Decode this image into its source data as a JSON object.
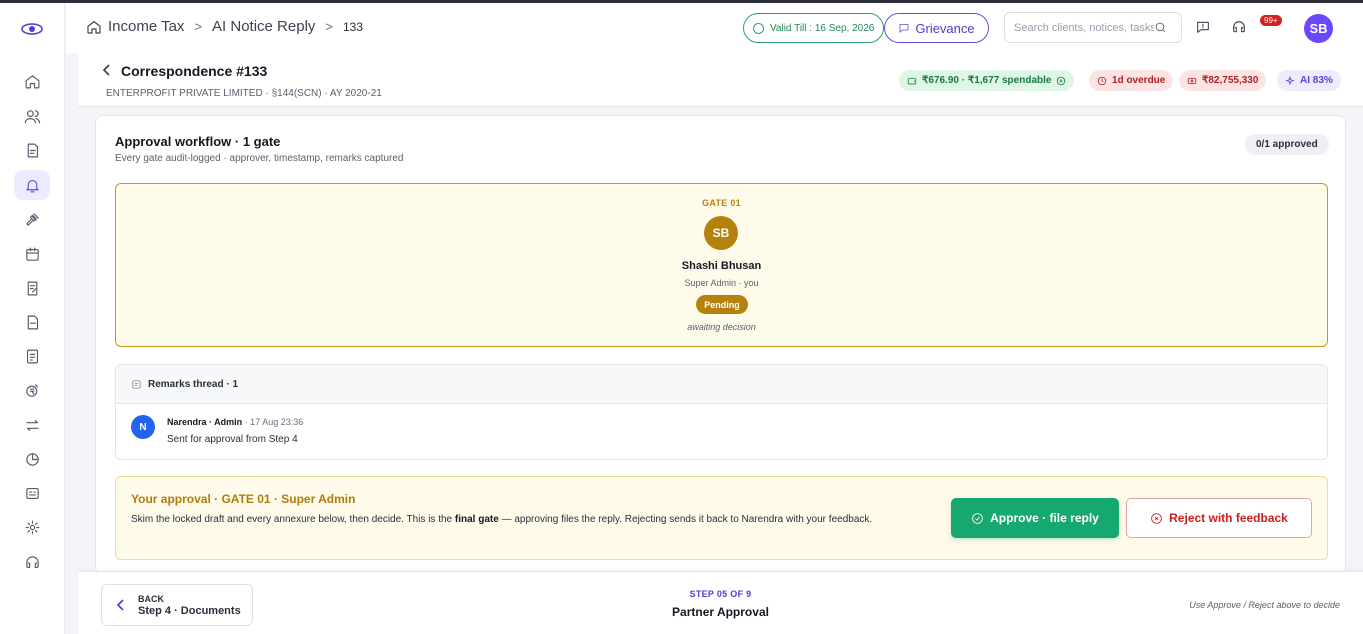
{
  "header": {
    "breadcrumbs": [
      "Income Tax",
      "AI Notice Reply",
      "133"
    ],
    "valid_till": "Valid Till : 16 Sep, 2026",
    "grievance_label": "Grievance",
    "search_placeholder": "Search clients, notices, tasks…",
    "notification_count": "99+",
    "user_initials": "SB"
  },
  "sidebar": {
    "items": [
      {
        "icon": "home-icon"
      },
      {
        "icon": "users-icon"
      },
      {
        "icon": "document-icon"
      },
      {
        "icon": "bell-icon",
        "active": true
      },
      {
        "icon": "gavel-icon"
      },
      {
        "icon": "calendar-icon"
      },
      {
        "icon": "edit-document-icon"
      },
      {
        "icon": "file-icon"
      },
      {
        "icon": "report-icon"
      },
      {
        "icon": "currency-icon"
      },
      {
        "icon": "transfer-icon"
      },
      {
        "icon": "pie-chart-icon"
      },
      {
        "icon": "id-card-icon"
      },
      {
        "icon": "settings-icon"
      },
      {
        "icon": "support-icon"
      }
    ]
  },
  "title": {
    "heading": "Correspondence #133",
    "subtitle": "ENTERPROFIT PRIVATE LIMITED · §144(SCN) · AY 2020-21",
    "chips": {
      "wallet": "₹676.90 · ₹1,677 spendable",
      "overdue": "1d overdue",
      "amount": "₹82,755,330",
      "ai": "AI 83%"
    }
  },
  "workflow": {
    "title": "Approval workflow · 1 gate",
    "subtitle": "Every gate audit-logged · approver, timestamp, remarks captured",
    "approved_count": "0/1 approved",
    "gate": {
      "label": "GATE 01",
      "initials": "SB",
      "name": "Shashi Bhusan",
      "role": "Super Admin · you",
      "status": "Pending",
      "note": "awaiting decision"
    }
  },
  "remarks": {
    "title": "Remarks thread · 1",
    "items": [
      {
        "initial": "N",
        "author": "Narendra · Admin",
        "time": " · 17 Aug 23:36",
        "text": "Sent for approval from Step 4"
      }
    ]
  },
  "approval": {
    "title": "Your approval · GATE 01 · Super Admin",
    "text_before": "Skim the locked draft and every annexure below, then decide. This is the ",
    "text_bold": "final gate",
    "text_after": " — approving files the reply. Rejecting sends it back to Narendra with your feedback.",
    "approve_label": "Approve · file reply",
    "reject_label": "Reject with feedback"
  },
  "footer": {
    "back_label": "BACK",
    "back_step": "Step 4 · Documents",
    "step_number": "STEP 05 OF 9",
    "step_name": "Partner Approval",
    "hint": "Use Approve / Reject above to decide"
  },
  "colors": {
    "accent": "#5b4fe0",
    "gate_gold": "#b5830d",
    "approve_green": "#16a86e",
    "reject_red": "#cc1f1f"
  }
}
